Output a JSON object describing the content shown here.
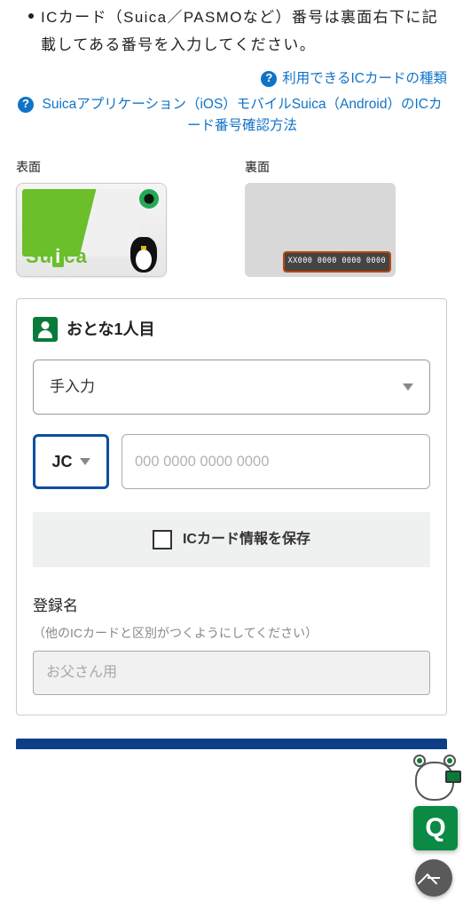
{
  "note": "ICカード（Suica／PASMOなど）番号は裏面右下に記載してある番号を入力してください。",
  "help_links": {
    "card_types": "利用できるICカードの種類",
    "app_guide": "Suicaアプリケーション（iOS）モバイルSuica（Android）のICカード番号確認方法"
  },
  "card_illustration": {
    "front_label": "表面",
    "back_label": "裏面",
    "brand_prefix": "Su",
    "brand_i": "i",
    "brand_suffix": "ca",
    "sample_number": "XX000 0000 0000 0000"
  },
  "form": {
    "person_title": "おとな1人目",
    "input_mode": "手入力",
    "prefix": "JC",
    "number_placeholder": "000 0000 0000 0000",
    "save_label": "ICカード情報を保存",
    "reg_name_label": "登録名",
    "reg_name_hint": "（他のICカードと区別がつくようにしてください）",
    "reg_name_placeholder": "お父さん用"
  },
  "fab": {
    "q": "Q"
  }
}
